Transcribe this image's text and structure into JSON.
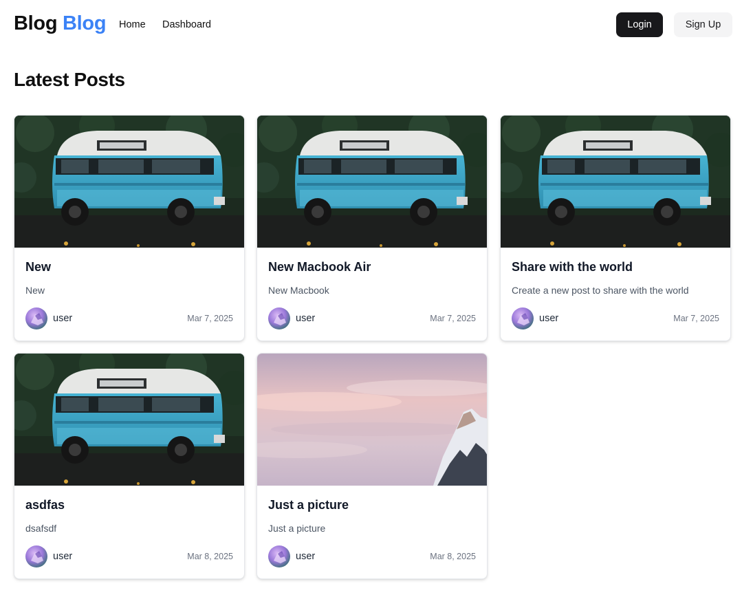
{
  "header": {
    "brand_part1": "Blog",
    "brand_part2": "Blog",
    "nav": [
      {
        "label": "Home"
      },
      {
        "label": "Dashboard"
      }
    ],
    "login_label": "Login",
    "signup_label": "Sign Up"
  },
  "main": {
    "title": "Latest Posts",
    "posts": [
      {
        "title": "New",
        "excerpt": "New",
        "author": "user",
        "date": "Mar 7, 2025",
        "image": "blue-van"
      },
      {
        "title": "New Macbook Air",
        "excerpt": "New Macbook",
        "author": "user",
        "date": "Mar 7, 2025",
        "image": "blue-van"
      },
      {
        "title": "Share with the world",
        "excerpt": "Create a new post to share with the world",
        "author": "user",
        "date": "Mar 7, 2025",
        "image": "blue-van"
      },
      {
        "title": "asdfas",
        "excerpt": "dsafsdf",
        "author": "user",
        "date": "Mar 8, 2025",
        "image": "blue-van"
      },
      {
        "title": "Just a picture",
        "excerpt": "Just a picture",
        "author": "user",
        "date": "Mar 8, 2025",
        "image": "sunset-mountain"
      }
    ]
  },
  "colors": {
    "accent": "#3b82f6",
    "primary_button": "#18181b",
    "secondary_button": "#f4f4f5"
  }
}
